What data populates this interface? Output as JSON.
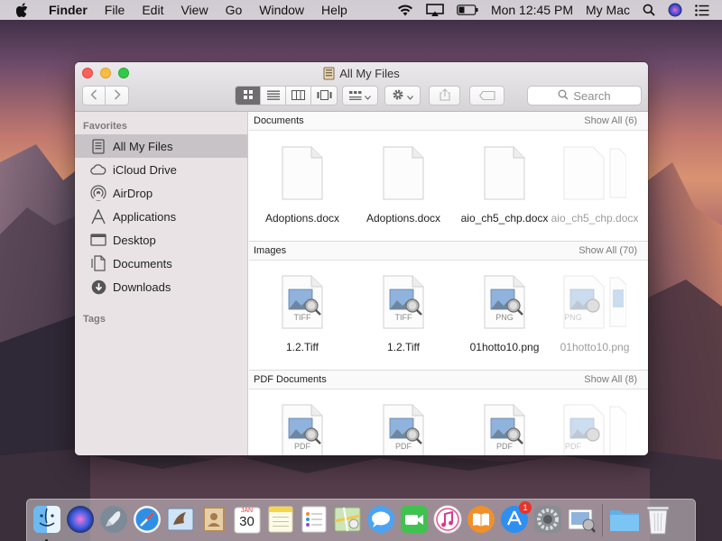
{
  "menubar": {
    "app_name": "Finder",
    "menus": [
      "File",
      "Edit",
      "View",
      "Go",
      "Window",
      "Help"
    ],
    "time": "Mon 12:45 PM",
    "user": "My Mac"
  },
  "window": {
    "title": "All My Files",
    "search_placeholder": "Search"
  },
  "sidebar": {
    "favorites_header": "Favorites",
    "tags_header": "Tags",
    "items": [
      {
        "label": "All My Files",
        "icon": "all-files-icon"
      },
      {
        "label": "iCloud Drive",
        "icon": "cloud-icon"
      },
      {
        "label": "AirDrop",
        "icon": "airdrop-icon"
      },
      {
        "label": "Applications",
        "icon": "applications-icon"
      },
      {
        "label": "Desktop",
        "icon": "desktop-icon"
      },
      {
        "label": "Documents",
        "icon": "documents-icon"
      },
      {
        "label": "Downloads",
        "icon": "downloads-icon"
      }
    ]
  },
  "sections": [
    {
      "name": "Documents",
      "show_all": "Show All (6)",
      "files": [
        {
          "name": "Adoptions.docx",
          "badge": ""
        },
        {
          "name": "Adoptions.docx",
          "badge": ""
        },
        {
          "name": "aio_ch5_chp.docx",
          "badge": ""
        },
        {
          "name": "aio_ch5_chp.docx",
          "badge": ""
        }
      ]
    },
    {
      "name": "Images",
      "show_all": "Show All (70)",
      "files": [
        {
          "name": "1.2.Tiff",
          "badge": "TIFF"
        },
        {
          "name": "1.2.Tiff",
          "badge": "TIFF"
        },
        {
          "name": "01hotto10.png",
          "badge": "PNG"
        },
        {
          "name": "01hotto10.png",
          "badge": "PNG"
        }
      ]
    },
    {
      "name": "PDF Documents",
      "show_all": "Show All (8)",
      "files": [
        {
          "name": "",
          "badge": "PDF"
        },
        {
          "name": "",
          "badge": "PDF"
        },
        {
          "name": "",
          "badge": "PDF"
        },
        {
          "name": "",
          "badge": "PDF"
        }
      ]
    }
  ],
  "dock": {
    "calendar_month": "JAN",
    "calendar_day": "30",
    "appstore_badge": "1"
  },
  "colors": {
    "accent": "#6f6d6f",
    "close": "#fc605c",
    "minimize": "#fdbc40",
    "maximize": "#34c84a"
  }
}
